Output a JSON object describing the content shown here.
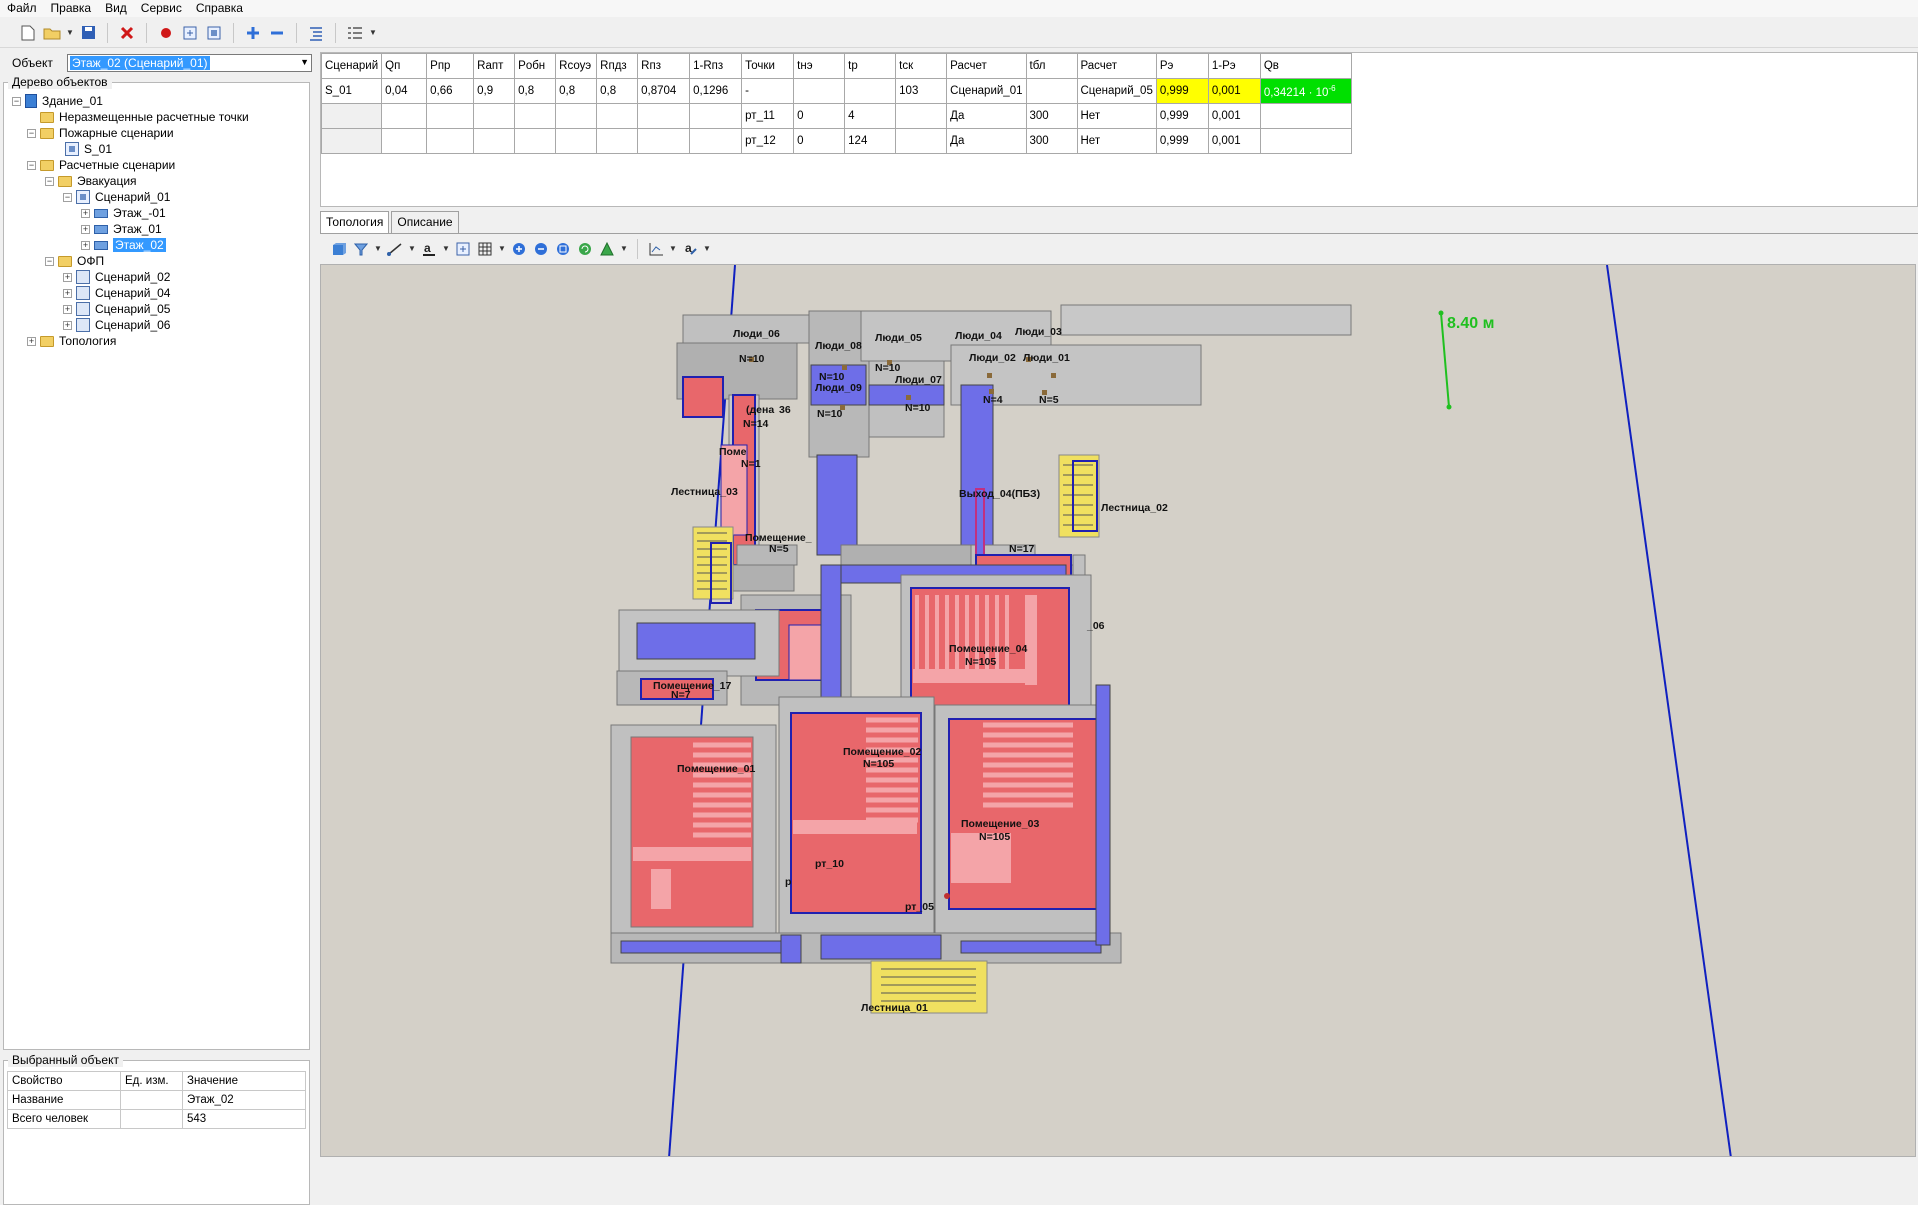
{
  "menu": [
    "Файл",
    "Правка",
    "Вид",
    "Сервис",
    "Справка"
  ],
  "object": {
    "label": "Объект",
    "value": "Этаж_02 (Сценарий_01)"
  },
  "tree": {
    "title": "Дерево объектов",
    "nodes": [
      {
        "label": "Здание_01",
        "icon": "building-icon"
      },
      {
        "label": "Неразмещенные расчетные точки",
        "icon": "folder-icon"
      },
      {
        "label": "Пожарные сценарии",
        "icon": "folder-icon"
      },
      {
        "label": "S_01",
        "icon": "scenario-icon"
      },
      {
        "label": "Расчетные сценарии",
        "icon": "folder-icon"
      },
      {
        "label": "Эвакуация",
        "icon": "folder-icon"
      },
      {
        "label": "Сценарий_01",
        "icon": "scenario-icon"
      },
      {
        "label": "Этаж_-01",
        "icon": "floor-icon"
      },
      {
        "label": "Этаж_01",
        "icon": "floor-icon"
      },
      {
        "label": "Этаж_02",
        "icon": "floor-icon",
        "selected": true
      },
      {
        "label": "ОФП",
        "icon": "folder-icon"
      },
      {
        "label": "Сценарий_02",
        "icon": "ofp-scenario-icon"
      },
      {
        "label": "Сценарий_04",
        "icon": "ofp-scenario-icon"
      },
      {
        "label": "Сценарий_05",
        "icon": "ofp-scenario-icon"
      },
      {
        "label": "Сценарий_06",
        "icon": "ofp-scenario-icon"
      },
      {
        "label": "Топология",
        "icon": "folder-icon"
      }
    ]
  },
  "selected_object": {
    "title": "Выбранный объект",
    "headers": [
      "Свойство",
      "Ед. изм.",
      "Значение"
    ],
    "rows": [
      [
        "Название",
        "",
        "Этаж_02"
      ],
      [
        "Всего человек",
        "",
        "543"
      ]
    ]
  },
  "grid": {
    "headers": [
      "Сценарий",
      "Qп",
      "Pпр",
      "Rапт",
      "Pобн",
      "Rсоуэ",
      "Rпдз",
      "Rпз",
      "1-Rпз",
      "Точки",
      "tнэ",
      "tр",
      "tск",
      "Расчет",
      "tбл",
      "Расчет",
      "Pэ",
      "1-Pэ",
      "Qв"
    ],
    "rows": [
      [
        "S_01",
        "0,04",
        "0,66",
        "0,9",
        "0,8",
        "0,8",
        "0,8",
        "0,8704",
        "0,1296",
        "-",
        "",
        "",
        "103",
        "Сценарий_01",
        "",
        "Сценарий_05",
        "0,999",
        "0,001",
        "0,34214 · 10"
      ],
      [
        "",
        "",
        "",
        "",
        "",
        "",
        "",
        "",
        "",
        "рт_11",
        "0",
        "4",
        "",
        "Да",
        "300",
        "Нет",
        "0,999",
        "0,001",
        ""
      ],
      [
        "",
        "",
        "",
        "",
        "",
        "",
        "",
        "",
        "",
        "рт_12",
        "0",
        "124",
        "",
        "Да",
        "300",
        "Нет",
        "0,999",
        "0,001",
        ""
      ]
    ],
    "qv_exponent": "-6"
  },
  "tabs": [
    "Топология",
    "Описание"
  ],
  "colors": {
    "room_fill": "#e8676b",
    "corridor_fill": "#6e6ee8",
    "wall_gray": "#b8b8b8",
    "stair_yellow": "#f0e060",
    "canvas_bg": "#d4d0c8",
    "selection_blue": "#3399ff"
  },
  "canvas": {
    "scale_label": "8.40 м",
    "labels": {
      "people_06": "Люди_06",
      "n10_a": "N=10",
      "people_08": "Люди_08",
      "n10_b": "N=10",
      "people_09": "Люди_09",
      "n10_c": "N=10",
      "people_05": "Люди_05",
      "n10_d": "N=10",
      "people_07": "Люди_07",
      "n10_e": "N=10",
      "people_04": "Люди_04",
      "people_03": "Люди_03",
      "people_02": "Люди_02",
      "people_01": "Люди_01",
      "n4": "N=4",
      "n5_a": "N=5",
      "room_partial_a": "(дена",
      "n14": "N=14",
      "frag_36": "36",
      "room_partial_b": "Поме",
      "n1": "N=1",
      "stair_03": "Лестница_03",
      "stair_02": "Лестница_02",
      "room_partial_c": "Помещение_",
      "n5_b": "N=5",
      "exit_04": "Выход_04(ПБЗ)",
      "n17": "N=17",
      "room_06": "_06",
      "room_04": "Помещение_04",
      "n105_a": "N=105",
      "room_partial_d": "Помещение_17",
      "n7": "N=7",
      "room_01": "Помещение_01",
      "room_02": "Помещение_02",
      "n105_b": "N=105",
      "room_03": "Помещение_03",
      "n105_c": "N=105",
      "rt_10": "рт_10",
      "p_frag": "р",
      "rt_05": "рт_05",
      "stair_01": "Лестница_01"
    }
  }
}
